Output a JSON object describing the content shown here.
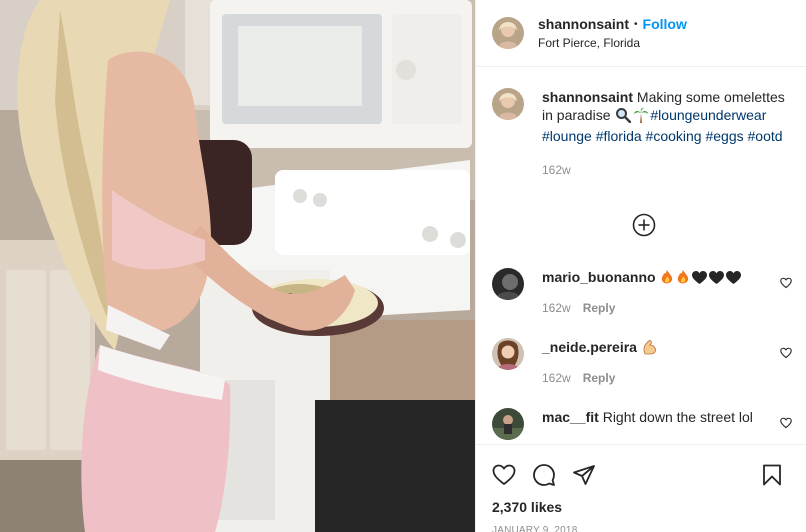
{
  "post": {
    "username": "shannonsaint",
    "separator": "•",
    "follow_label": "Follow",
    "location": "Fort Pierce, Florida"
  },
  "caption": {
    "username": "shannonsaint",
    "text": "Making some omelettes in paradise",
    "emojis": [
      "magnifying-glass-emoji",
      "palm-tree-emoji"
    ],
    "hashtags": [
      "#loungeunderwear",
      "#lounge",
      "#florida",
      "#cooking",
      "#eggs",
      "#ootd"
    ],
    "time": "162w"
  },
  "comments": [
    {
      "username": "mario_buonanno",
      "text": "",
      "emojis": [
        "fire-emoji",
        "fire-emoji",
        "black-heart-emoji",
        "black-heart-emoji",
        "black-heart-emoji"
      ],
      "time": "162w",
      "reply_label": "Reply"
    },
    {
      "username": "_neide.pereira",
      "text": "",
      "emojis": [
        "flexed-biceps-emoji"
      ],
      "time": "162w",
      "reply_label": "Reply"
    },
    {
      "username": "mac__fit",
      "text": "Right down the street lol",
      "emojis": [],
      "time": "",
      "reply_label": ""
    }
  ],
  "actions": {
    "likes": "2,370 likes",
    "date": "JANUARY 9, 2018"
  },
  "icons": {
    "like": "heart-outline-icon",
    "comment": "comment-bubble-icon",
    "share": "paper-plane-icon",
    "save": "bookmark-icon",
    "load_more": "plus-circle-icon"
  },
  "colors": {
    "follow": "#0095f6",
    "hashtag": "#00376b",
    "secondary_text": "#8e8e8e",
    "primary_text": "#262626",
    "divider": "#efefef"
  }
}
